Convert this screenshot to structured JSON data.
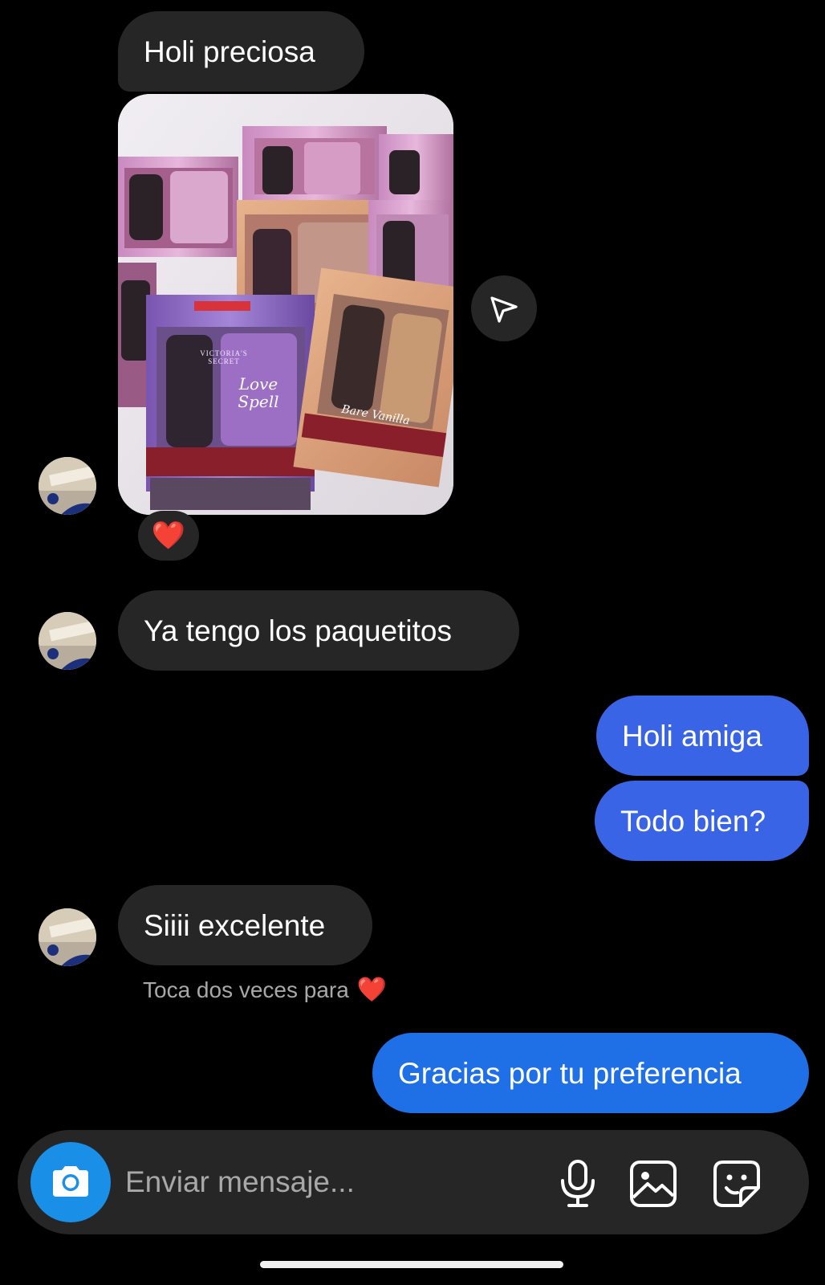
{
  "messages": {
    "m1": {
      "text": "Holi preciosa"
    },
    "m2": {
      "text": "Ya tengo los paquetitos"
    },
    "m3": {
      "text": "Holi amiga"
    },
    "m4": {
      "text": "Todo bien?"
    },
    "m5": {
      "text": "Siiii excelente"
    },
    "m6": {
      "text": "Gracias por tu preferencia"
    }
  },
  "photo": {
    "labels": {
      "brand": "VICTORIA'S SECRET",
      "scent_a": "Love Spell",
      "scent_b": "Bare Vanilla"
    }
  },
  "reaction": {
    "emoji": "❤️"
  },
  "hint": {
    "text": "Toca dos veces para",
    "emoji": "❤️"
  },
  "composer": {
    "placeholder": "Enviar mensaje..."
  },
  "icons": {
    "share": "send-arrow-icon",
    "camera": "camera-icon",
    "microphone": "microphone-icon",
    "gallery": "gallery-icon",
    "sticker": "sticker-icon"
  },
  "colors": {
    "background": "#000000",
    "incoming_bubble": "#262626",
    "outgoing_bubble_a": "#3a64e6",
    "outgoing_bubble_b": "#1f6fe6",
    "camera_button": "#1a8fe8",
    "hint_text": "#a8a8a8"
  }
}
